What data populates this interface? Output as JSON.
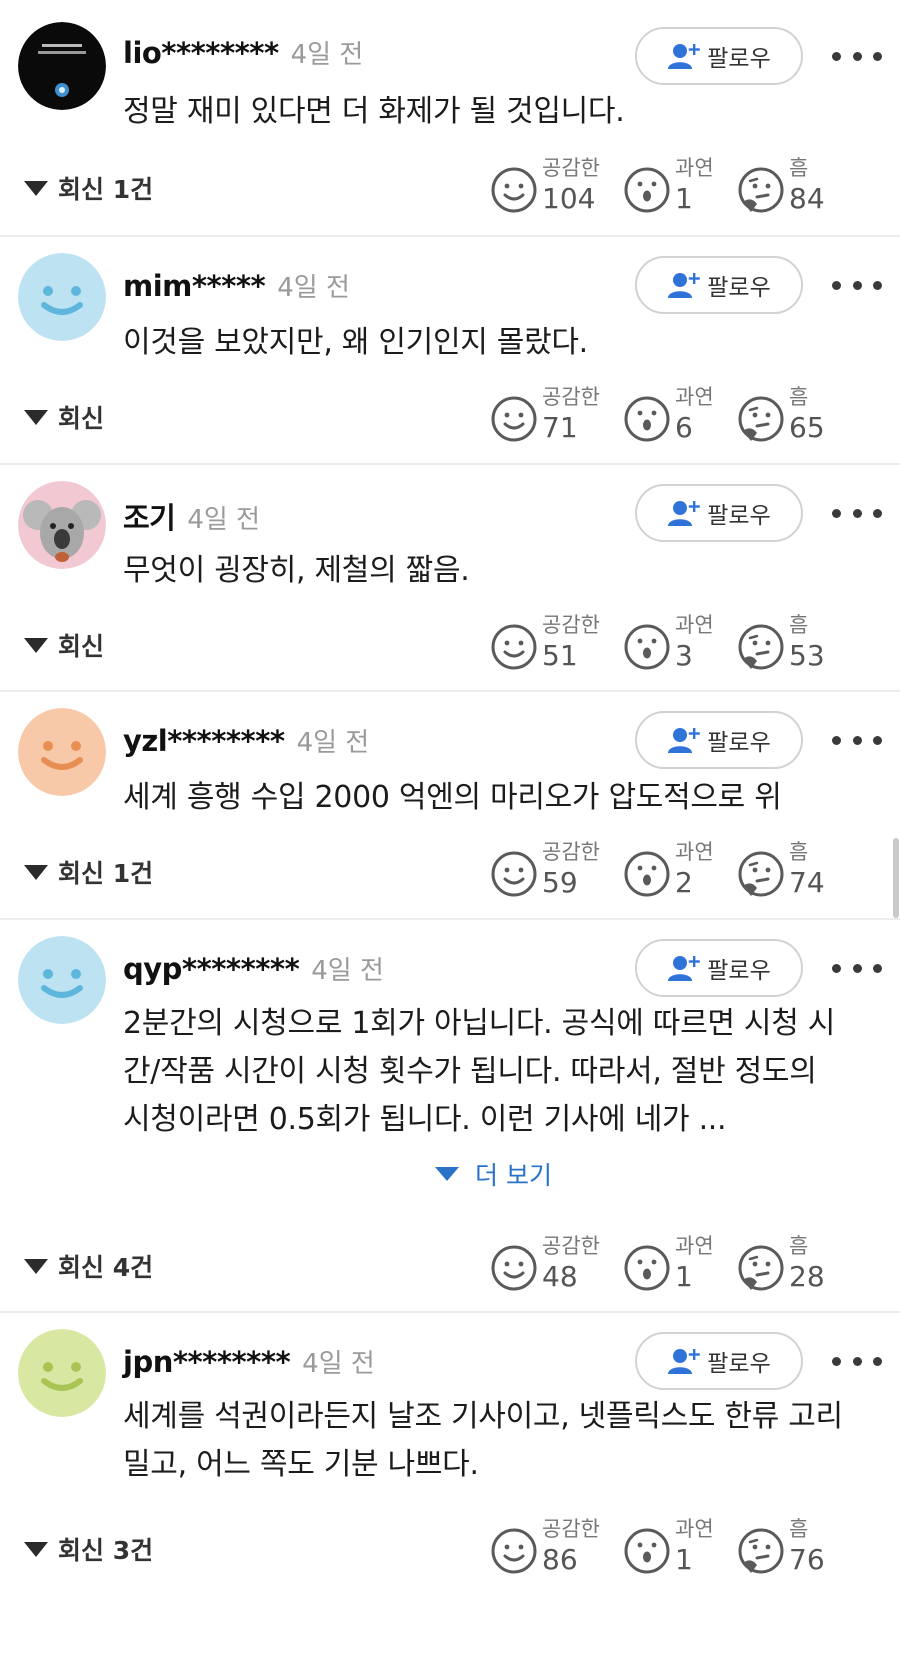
{
  "follow_label": "팔로우",
  "more_label": "더 보기",
  "reaction_labels": {
    "like": "공감한",
    "wow": "과연",
    "hmm": "흠"
  },
  "comments": [
    {
      "username": "lio********",
      "time": "4일 전",
      "lines": [
        "정말 재미 있다면 더 화제가 될 것입니다."
      ],
      "reply": "회신 1건",
      "like": "104",
      "wow": "1",
      "hmm": "84"
    },
    {
      "username": "mim*****",
      "time": "4일 전",
      "lines": [
        "이것을 보았지만, 왜 인기인지 몰랐다."
      ],
      "reply": "회신",
      "like": "71",
      "wow": "6",
      "hmm": "65"
    },
    {
      "username": "조기",
      "time": "4일 전",
      "lines": [
        "무엇이 굉장히, 제철의 짧음."
      ],
      "reply": "회신",
      "like": "51",
      "wow": "3",
      "hmm": "53"
    },
    {
      "username": "yzl********",
      "time": "4일 전",
      "lines": [
        "세계 흥행 수입 2000 억엔의 마리오가 압도적으로 위"
      ],
      "reply": "회신 1건",
      "like": "59",
      "wow": "2",
      "hmm": "74"
    },
    {
      "username": "qyp********",
      "time": "4일 전",
      "lines": [
        "2분간의 시청으로 1회가 아닙니다. 공식에 따르면 시청 시",
        "간/작품 시간이 시청 횟수가 됩니다. 따라서, 절반 정도의",
        "시청이라면 0.5회가 됩니다. 이런 기사에 네가 ..."
      ],
      "reply": "회신 4건",
      "like": "48",
      "wow": "1",
      "hmm": "28"
    },
    {
      "username": "jpn********",
      "time": "4일 전",
      "lines": [
        "세계를 석권이라든지 날조 기사이고, 넷플릭스도 한류 고리",
        "밀고, 어느 쪽도 기분 나쁘다."
      ],
      "reply": "회신 3건",
      "like": "86",
      "wow": "1",
      "hmm": "76"
    }
  ]
}
